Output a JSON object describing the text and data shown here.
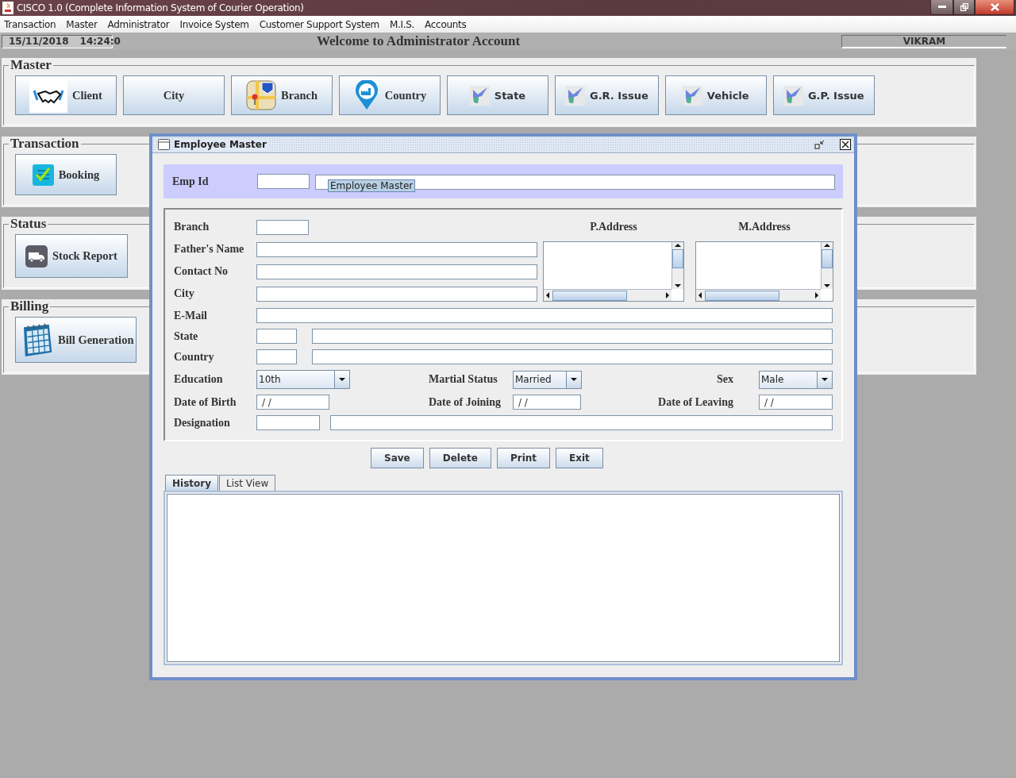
{
  "window": {
    "title": "CISCO 1.0 (Complete Information System of Courier Operation)"
  },
  "menu": [
    {
      "label": "Transaction"
    },
    {
      "label": "Master"
    },
    {
      "label": "Administrator"
    },
    {
      "label": "Invoice System"
    },
    {
      "label": "Customer Support System"
    },
    {
      "label": "M.I.S."
    },
    {
      "label": "Accounts"
    }
  ],
  "header": {
    "date": "15/11/2018",
    "time": "14:24:0",
    "welcome": "Welcome to Administrator Account",
    "user": "VIKRAM"
  },
  "sections": [
    {
      "title": "Master",
      "buttons": [
        {
          "label": "Client",
          "kind": "handshake"
        },
        {
          "label": "City",
          "kind": "plain"
        },
        {
          "label": "Branch",
          "kind": "map"
        },
        {
          "label": "Country",
          "kind": "pin"
        },
        {
          "label": "State",
          "kind": "region"
        },
        {
          "label": "G.R. Issue",
          "kind": "region"
        },
        {
          "label": "Vehicle",
          "kind": "region"
        },
        {
          "label": "G.P. Issue",
          "kind": "region"
        }
      ]
    },
    {
      "title": "Transaction",
      "buttons": [
        {
          "label": "Booking",
          "kind": "checklist"
        }
      ]
    },
    {
      "title": "Status",
      "buttons": [
        {
          "label": "Stock Report",
          "kind": "truck"
        }
      ]
    },
    {
      "title": "Billing",
      "buttons": [
        {
          "label": "Bill Generation",
          "kind": "calendar"
        }
      ]
    }
  ],
  "employee_master": {
    "title": "Employee Master",
    "emp_id": {
      "label": "Emp Id",
      "tooltip": "Employee Master"
    },
    "form": {
      "branch": "Branch",
      "fathers_name": "Father's Name",
      "contact_no": "Contact No",
      "city": "City",
      "p_address": "P.Address",
      "m_address": "M.Address",
      "email": "E-Mail",
      "state": "State",
      "country": "Country",
      "education": {
        "label": "Education",
        "value": "10th"
      },
      "marital_status": {
        "label": "Martial Status",
        "value": "Married"
      },
      "sex": {
        "label": "Sex",
        "value": "Male"
      },
      "date_of_birth": {
        "label": "Date of Birth",
        "value": "/ /"
      },
      "date_of_joining": {
        "label": "Date of Joining",
        "value": "/ /"
      },
      "date_of_leaving": {
        "label": "Date of Leaving",
        "value": "/ /"
      },
      "designation": "Designation"
    },
    "buttons": [
      {
        "label": "Save"
      },
      {
        "label": "Delete"
      },
      {
        "label": "Print"
      },
      {
        "label": "Exit"
      }
    ],
    "tabs": [
      {
        "label": "History",
        "selected": true
      },
      {
        "label": "List View",
        "selected": false
      }
    ]
  }
}
